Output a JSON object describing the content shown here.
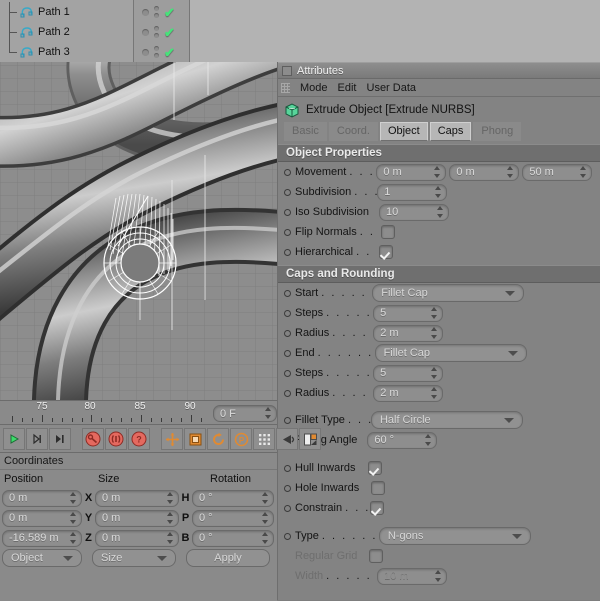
{
  "viewport": {
    "name": "perspective-viewport",
    "selected_object": "extruded-tube",
    "background_color": "#8a8a8a",
    "grid_color": "#7a7a7a",
    "selection_color": "#ffffff"
  },
  "object_manager": {
    "rows": [
      {
        "label": "Path 1",
        "icon": "spline-path-icon",
        "visible_check": "✔"
      },
      {
        "label": "Path 2",
        "icon": "spline-path-icon",
        "visible_check": "✔"
      },
      {
        "label": "Path 3",
        "icon": "spline-path-icon",
        "visible_check": "✔"
      }
    ]
  },
  "attributes": {
    "title": "Attributes",
    "menu": [
      "Mode",
      "Edit",
      "User Data"
    ],
    "object_title": "Extrude Object [Extrude NURBS]",
    "object_icon": "extrude-nurbs-icon",
    "tabs": [
      {
        "label": "Basic",
        "active": false
      },
      {
        "label": "Coord.",
        "active": false
      },
      {
        "label": "Object",
        "active": true
      },
      {
        "label": "Caps",
        "active": true
      },
      {
        "label": "Phong",
        "active": false
      }
    ],
    "object_properties": {
      "section_title": "Object Properties",
      "movement": {
        "label": "Movement",
        "dots": ". . .",
        "x": "0 m",
        "y": "0 m",
        "z": "50 m"
      },
      "subdivision": {
        "label": "Subdivision",
        "dots": ". . .",
        "value": "1"
      },
      "iso_subdivision": {
        "label": "Iso Subdivision",
        "dots": "",
        "value": "10"
      },
      "flip_normals": {
        "label": "Flip Normals",
        "dots": ". .",
        "checked": false
      },
      "hierarchical": {
        "label": "Hierarchical",
        "dots": ". .",
        "checked": true
      }
    },
    "caps_and_rounding": {
      "section_title": "Caps and Rounding",
      "start": {
        "label": "Start",
        "dots": ". . . . . . .",
        "value": "Fillet Cap"
      },
      "start_steps": {
        "label": "Steps",
        "dots": ". . . . . .",
        "value": "5"
      },
      "start_radius": {
        "label": "Radius",
        "dots": ". . . . .",
        "value": "2 m"
      },
      "end": {
        "label": "End",
        "dots": ". . . . . . .",
        "value": "Fillet Cap"
      },
      "end_steps": {
        "label": "Steps",
        "dots": ". . . . . .",
        "value": "5"
      },
      "end_radius": {
        "label": "Radius",
        "dots": ". . . . .",
        "value": "2 m"
      },
      "fillet_type": {
        "label": "Fillet Type",
        "dots": ". . .",
        "value": "Half Circle"
      },
      "phong_angle": {
        "label": "Phong Angle",
        "dots": "",
        "value": "60 °"
      },
      "hull_inwards": {
        "label": "Hull Inwards",
        "dots": "",
        "checked": true
      },
      "hole_inwards": {
        "label": "Hole Inwards",
        "dots": "",
        "checked": false
      },
      "constrain": {
        "label": "Constrain",
        "dots": ". . .",
        "checked": true
      },
      "type": {
        "label": "Type",
        "dots": ". . . . . . . .",
        "value": "N-gons"
      },
      "regular_grid": {
        "label": "Regular Grid",
        "dots": "",
        "checked": false,
        "disabled": true
      },
      "width": {
        "label": "Width",
        "dots": ". . . . . . .",
        "value": "10 m",
        "disabled": true
      }
    }
  },
  "timeline": {
    "ticks": [
      "75",
      "80",
      "85",
      "90"
    ],
    "current_frame": "0 F",
    "transport_buttons": [
      "play-button",
      "step-forward-button",
      "go-to-end-button"
    ],
    "record_buttons": [
      "record-keyframe-button",
      "autokey-button",
      "keyframe-selection-button"
    ],
    "tool_buttons": [
      "move-tool-icon",
      "scale-tool-icon",
      "rotate-tool-icon",
      "parametric-tool-icon",
      "grid-snap-icon",
      "magnet-icon",
      "layout-icon"
    ]
  },
  "coordinates": {
    "title": "Coordinates",
    "headers": [
      "Position",
      "Size",
      "Rotation"
    ],
    "rows": [
      {
        "position": "0 m",
        "axis": "X",
        "size": "0 m",
        "rot_axis": "H",
        "rotation": "0 °"
      },
      {
        "position": "0 m",
        "axis": "Y",
        "size": "0 m",
        "rot_axis": "P",
        "rotation": "0 °"
      },
      {
        "position": "-16.589 m",
        "axis": "Z",
        "size": "0 m",
        "rot_axis": "B",
        "rotation": "0 °"
      }
    ],
    "mode_dropdown": "Object",
    "size_dropdown": "Size",
    "apply_button": "Apply"
  }
}
